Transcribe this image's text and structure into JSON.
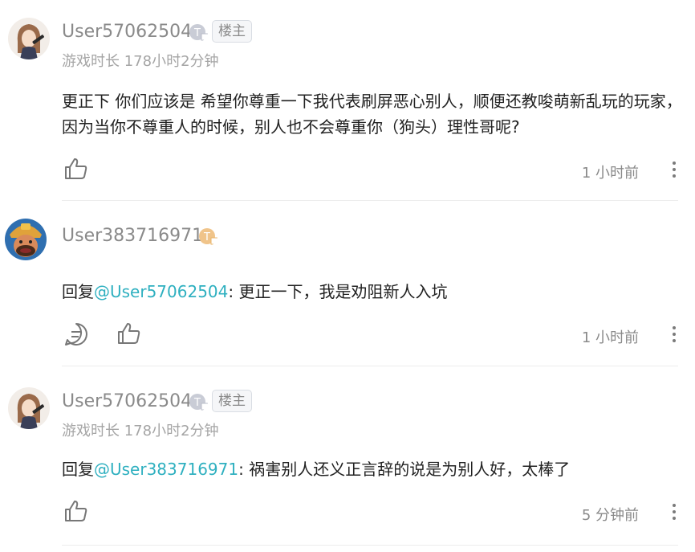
{
  "comments": [
    {
      "username": "User57062504",
      "owner_tag": "楼主",
      "playtime": "游戏时长 178小时2分钟",
      "content": "更正下 你们应该是 希望你尊重一下我代表刷屏恶心别人，顺便还教唆萌新乱玩的玩家，因为当你不尊重人的时候，别人也不会尊重你（狗头）理性哥呢?",
      "time": "1 小时前"
    },
    {
      "username": "User383716971",
      "reply_prefix": "回复",
      "mention": "@User57062504",
      "content": ": 更正一下，我是劝阻新人入坑",
      "time": "1 小时前"
    },
    {
      "username": "User57062504",
      "owner_tag": "楼主",
      "playtime": "游戏时长 178小时2分钟",
      "reply_prefix": "回复",
      "mention": "@User383716971",
      "content": ": 祸害别人还义正言辞的说是为别人好，太棒了",
      "time": "5 分钟前"
    }
  ],
  "badges": {
    "silver_letter": "T",
    "gold_letter": "T"
  },
  "colors": {
    "mention": "#2fb0c0",
    "username": "#8a8a8a",
    "silver_badge": "#b9bcc8",
    "gold_badge": "#e8b56a"
  }
}
